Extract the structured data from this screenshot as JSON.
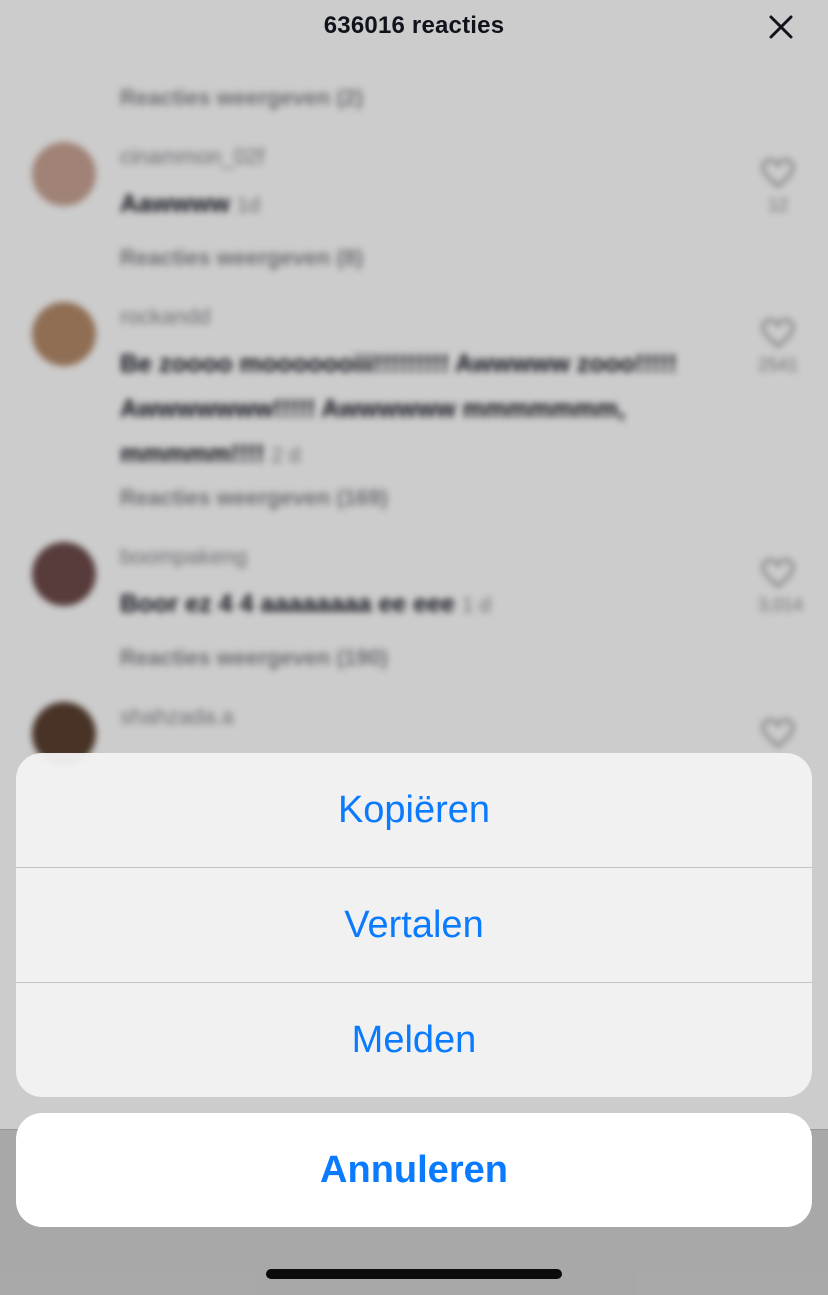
{
  "header": {
    "title": "636016 reacties",
    "close_icon": "close-icon"
  },
  "comments": [
    {
      "replies_label_before": "Reacties weergeven (2)",
      "user": "cinammon_02f",
      "text": "Aawwww",
      "time": "1d",
      "likes": "12",
      "replies_label": "Reacties weergeven (8)",
      "avatar_color": "#c9a394"
    },
    {
      "user": "rockandd",
      "text": "Be zoooo mooooooiii!!!!!!!!! Awwwww zooo!!!!! Awwwwwww!!!!! Awwwwww mmmmmmm,",
      "text_end": "mmmmm!!!!",
      "time": "2 d",
      "likes": "2541",
      "replies_label": "Reacties weergeven (169)",
      "avatar_color": "#b48a6a"
    },
    {
      "user": "boompakeng",
      "text": "Boor ez 4 4 aaaaaaaa ee eee",
      "time": "1 d",
      "likes": "3,014",
      "replies_label": "Reacties weergeven (190)",
      "avatar_color": "#6e4b4b"
    },
    {
      "user": "shahzada.a",
      "text": "",
      "time": "",
      "likes": "",
      "avatar_color": "#5a4030"
    }
  ],
  "actions": {
    "copy": "Kopiëren",
    "translate": "Vertalen",
    "report": "Melden",
    "cancel": "Annuleren"
  },
  "colors": {
    "accent": "#0a7aff",
    "sheet_bg": "#f3f3f3"
  }
}
